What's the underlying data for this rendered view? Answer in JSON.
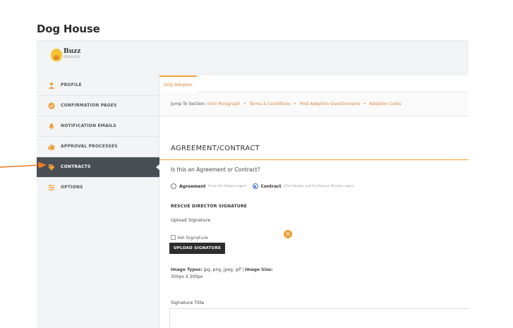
{
  "window": {
    "title": "Dog House"
  },
  "logo": {
    "name": "Buzz",
    "sub": "RESCUES"
  },
  "sidebar": {
    "items": [
      {
        "label": "PROFILE",
        "icon": "user-icon"
      },
      {
        "label": "CONFIRMATION PAGES",
        "icon": "check-circle-icon"
      },
      {
        "label": "NOTIFICATION EMAILS",
        "icon": "bell-icon"
      },
      {
        "label": "APPROVAL PROCESSES",
        "icon": "thumbs-up-icon"
      },
      {
        "label": "CONTRACTS",
        "icon": "tag-icon",
        "active": true
      },
      {
        "label": "OPTIONS",
        "icon": "sliders-icon"
      }
    ]
  },
  "main": {
    "tab": "Dog Adopter",
    "jump": {
      "label": "Jump To Section:",
      "links": [
        "Intro Paragraph",
        "Terms & Conditions",
        "Post Adoption Questionnaire",
        "Adoption Costs"
      ]
    },
    "section_title": "AGREEMENT/CONTRACT",
    "question": "Is this an Agreement or Contract?",
    "options": [
      {
        "label": "Agreement",
        "hint": "(Only the Adopter signs)",
        "selected": false
      },
      {
        "label": "Contract",
        "hint": "(The Adopter and the Rescue Director signs)",
        "selected": true
      }
    ],
    "signature_heading": "RESCUE DIRECTOR SIGNATURE",
    "upload_label": "Upload Signature",
    "broken_image_alt": "Vet Signature",
    "upload_button": "UPLOAD SIGNATURE",
    "image_types_label": "Image Types:",
    "image_types_value": "jpg, png, jpeg, gif",
    "separator": "|",
    "image_size_label": "Image Size:",
    "image_size_value": "300px X 200px",
    "signature_title_label": "Signature Title"
  },
  "colors": {
    "accent": "#f0a03a",
    "sidebar_active": "#4a4f56",
    "arrow": "#e87a22"
  }
}
